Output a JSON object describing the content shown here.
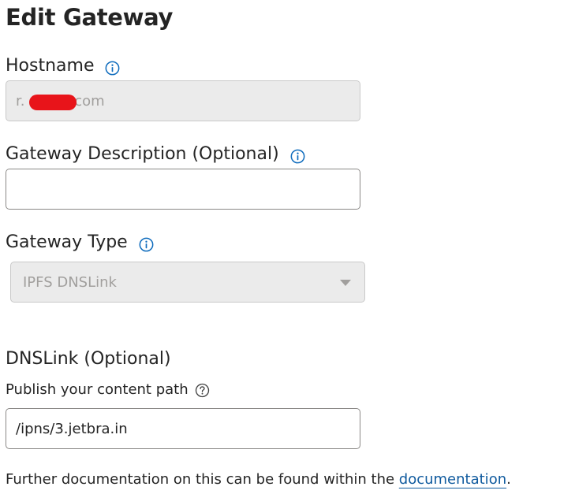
{
  "page": {
    "title": "Edit Gateway"
  },
  "hostname": {
    "label": "Hostname",
    "value_prefix": "r.",
    "value_suffix": "f.com"
  },
  "description": {
    "label": "Gateway Description (Optional)",
    "value": ""
  },
  "gateway_type": {
    "label": "Gateway Type",
    "selected": "IPFS DNSLink"
  },
  "dnslink": {
    "heading": "DNSLink (Optional)",
    "sublabel": "Publish your content path",
    "value": "/ipns/3.jetbra.in"
  },
  "footer": {
    "text_before": "Further documentation on this can be found within the ",
    "link_text": "documentation",
    "text_after": "."
  },
  "icons": {
    "info": "info-icon",
    "help": "help-question-icon",
    "dropdown": "chevron-down-icon"
  },
  "colors": {
    "info_icon": "#0f6cbd",
    "link": "#0f5a9e",
    "redaction": "#e8141a"
  }
}
